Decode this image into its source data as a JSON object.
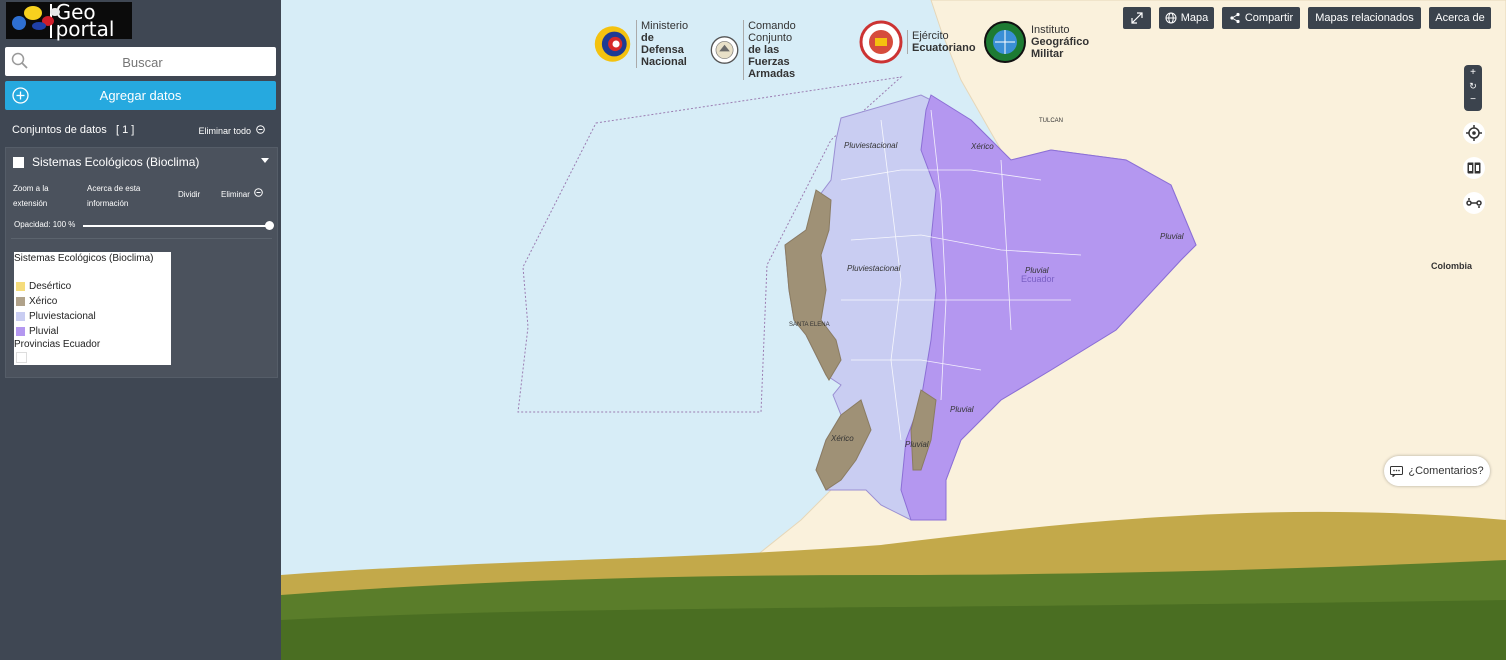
{
  "sidebar": {
    "logo_text": "Geo portal",
    "search_placeholder": "Buscar",
    "add_data_label": "Agregar datos",
    "datasets_label": "Conjuntos de datos",
    "datasets_count": "[ 1 ]",
    "clear_all_label": "Eliminar todo",
    "layer": {
      "title": "Sistemas Ecológicos (Bioclima)",
      "zoom_label_1": "Zoom a la",
      "zoom_label_2": "extensión",
      "about_label_1": "Acerca de esta",
      "about_label_2": "información",
      "split_label": "Dividir",
      "remove_label": "Eliminar",
      "opacity_label": "Opacidad: 100 %",
      "opacity_value": 1.0,
      "legend": {
        "title": "Sistemas Ecológicos (Bioclima)",
        "items": [
          {
            "label": "Desértico",
            "color": "#f5dc7c"
          },
          {
            "label": "Xérico",
            "color": "#b0a28a"
          },
          {
            "label": "Pluviestacional",
            "color": "#c9cdf2"
          },
          {
            "label": "Pluvial",
            "color": "#b497f0"
          }
        ],
        "sublayer": "Provincias Ecuador"
      }
    }
  },
  "toolbar": {
    "map_label": "Mapa",
    "share_label": "Compartir",
    "related_label": "Mapas relacionados",
    "about_label": "Acerca de"
  },
  "logos": {
    "mindef_1": "Ministerio",
    "mindef_2": "de Defensa",
    "mindef_3": "Nacional",
    "ccffaa_1": "Comando Conjunto",
    "ccffaa_2": "de las Fuerzas",
    "ccffaa_3": "Armadas",
    "ejercito_1": "Ejército",
    "ejercito_2": "Ecuatoriano",
    "igm_1": "Instituto",
    "igm_2": "Geográfico",
    "igm_3": "Militar"
  },
  "map": {
    "labels": {
      "colombia": "Colombia",
      "ecuador": "Ecuador",
      "pluviestacional_1": "Pluviestacional",
      "pluviestacional_2": "Pluviestacional",
      "xerico_1": "Xérico",
      "xerico_2": "Xérico",
      "pluvial_1": "Pluvial",
      "pluvial_2": "Pluvial",
      "pluvial_3": "Pluvial",
      "pluvial_4": "Pluvial",
      "tulcan": "TULCAN",
      "santa_elena": "SANTA ELENA"
    }
  },
  "comments_label": "¿Comentarios?"
}
